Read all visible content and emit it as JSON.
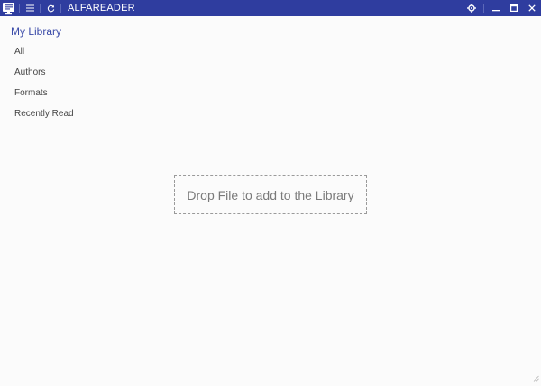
{
  "titlebar": {
    "app_name": "ALFAREADER",
    "icons": {
      "app": "reader-monitor-icon",
      "menu": "hamburger-menu-icon",
      "refresh": "refresh-icon",
      "settings": "gear-icon",
      "minimize": "minimize-icon",
      "maximize": "maximize-icon",
      "close": "close-icon"
    }
  },
  "sidebar": {
    "title": "My Library",
    "items": [
      {
        "label": "All"
      },
      {
        "label": "Authors"
      },
      {
        "label": "Formats"
      },
      {
        "label": "Recently Read"
      }
    ]
  },
  "main": {
    "dropzone_text": "Drop File to add to the Library"
  },
  "colors": {
    "titlebar_bg": "#2f3d9f",
    "accent_text": "#3a4aa8",
    "background": "#fbfbfb"
  }
}
